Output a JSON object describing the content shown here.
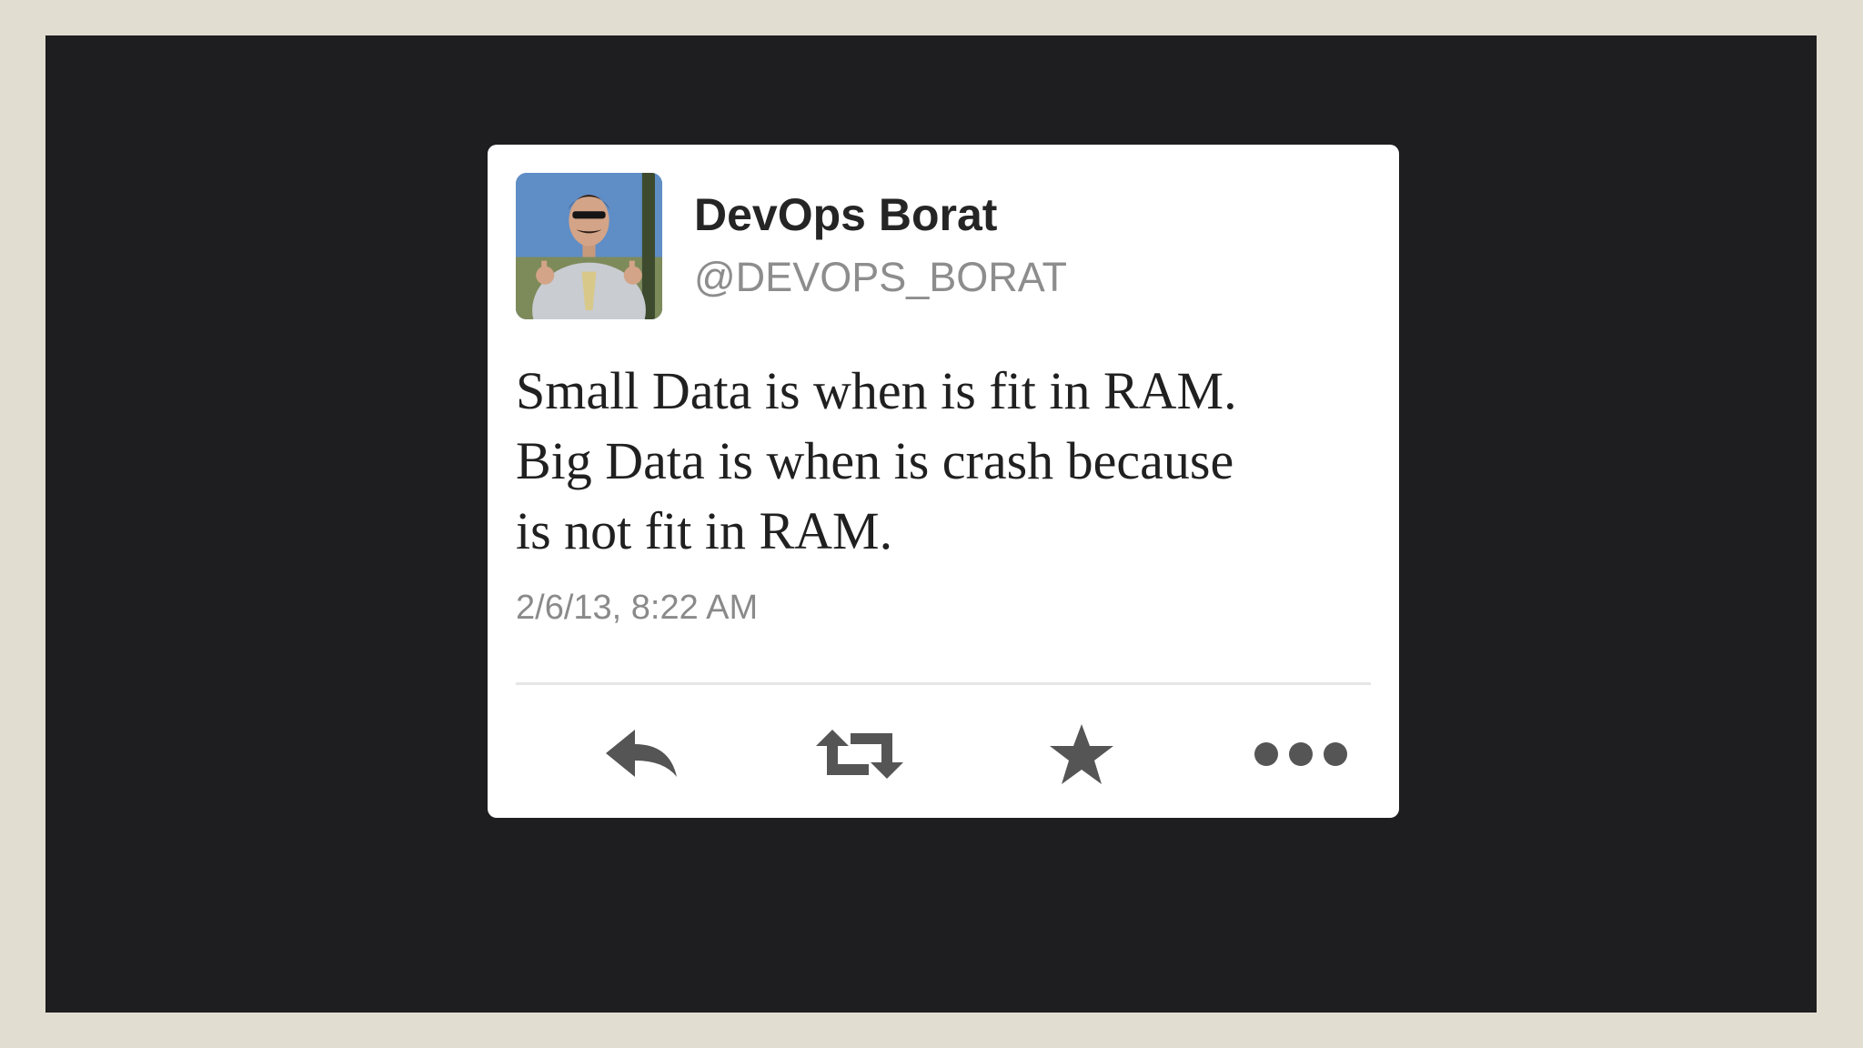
{
  "tweet": {
    "display_name": "DevOps Borat",
    "handle": "@DEVOPS_BORAT",
    "text_lines": [
      "Small Data is when is fit in RAM.",
      "Big Data is when is crash because",
      "is not fit in RAM."
    ],
    "timestamp": "2/6/13, 8:22 AM"
  },
  "actions": {
    "reply_icon": "reply-icon",
    "retweet_icon": "retweet-icon",
    "favorite_icon": "star-icon",
    "more_icon": "more-icon"
  },
  "colors": {
    "background": "#e1ddd1",
    "slide": "#1e1d20",
    "card": "#ffffff",
    "name": "#252525",
    "handle": "#8d8d8d",
    "icon": "#555555"
  }
}
